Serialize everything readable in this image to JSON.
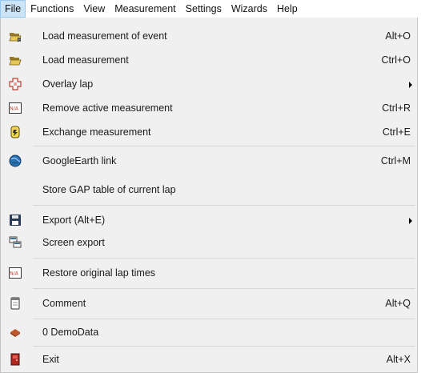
{
  "menubar": {
    "items": [
      "File",
      "Functions",
      "View",
      "Measurement",
      "Settings",
      "Wizards",
      "Help"
    ]
  },
  "file_menu": {
    "items": [
      {
        "label": "Load measurement of event",
        "shortcut": "Alt+O",
        "icon": "folder-event-icon"
      },
      {
        "label": "Load measurement",
        "shortcut": "Ctrl+O",
        "icon": "folder-open-icon"
      },
      {
        "label": "Overlay lap",
        "shortcut": "",
        "icon": "overlay-lap-icon",
        "submenu": true
      },
      {
        "label": "Remove active measurement",
        "shortcut": "Ctrl+R",
        "icon": "na-icon"
      },
      {
        "label": "Exchange measurement",
        "shortcut": "Ctrl+E",
        "icon": "exchange-icon"
      },
      {
        "label": "GoogleEarth link",
        "shortcut": "Ctrl+M",
        "icon": "globe-icon"
      },
      {
        "label": "Store GAP table of current lap",
        "shortcut": "",
        "icon": ""
      },
      {
        "label": "Export (Alt+E)",
        "shortcut": "",
        "icon": "floppy-disk-icon",
        "submenu": true
      },
      {
        "label": "Screen export",
        "shortcut": "",
        "icon": "screen-export-icon"
      },
      {
        "label": "Restore original lap times",
        "shortcut": "",
        "icon": "na-icon"
      },
      {
        "label": "Comment",
        "shortcut": "Alt+Q",
        "icon": "notepad-icon"
      },
      {
        "label": "0 DemoData",
        "shortcut": "",
        "icon": "data-book-icon"
      },
      {
        "label": "Exit",
        "shortcut": "Alt+X",
        "icon": "exit-door-icon"
      }
    ]
  }
}
